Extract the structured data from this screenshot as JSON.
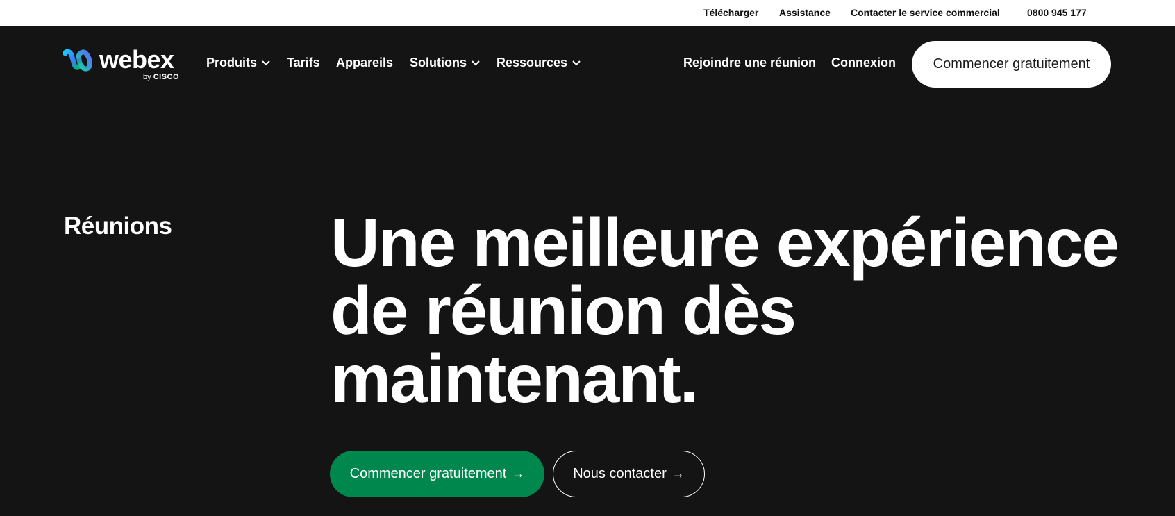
{
  "utility_bar": {
    "download": "Télécharger",
    "support": "Assistance",
    "contact_sales": "Contacter le service commercial",
    "phone": "0800 945 177"
  },
  "nav": {
    "logo_word": "webex",
    "logo_by": "by",
    "logo_cisco": "CISCO",
    "items": [
      {
        "label": "Produits",
        "has_dropdown": true
      },
      {
        "label": "Tarifs",
        "has_dropdown": false
      },
      {
        "label": "Appareils",
        "has_dropdown": false
      },
      {
        "label": "Solutions",
        "has_dropdown": true
      },
      {
        "label": "Ressources",
        "has_dropdown": true
      }
    ],
    "join_meeting": "Rejoindre une réunion",
    "login": "Connexion",
    "cta": "Commencer gratuitement"
  },
  "hero": {
    "eyebrow": "Réunions",
    "headline_lines": [
      "Une meilleure expérience",
      "de réunion dès",
      "maintenant."
    ],
    "primary_button": "Commencer gratuitement",
    "secondary_button": "Nous contacter",
    "arrow_glyph": "→"
  },
  "colors": {
    "background": "#141414",
    "utility_bar": "#ffffff",
    "primary_button": "#00874d"
  }
}
